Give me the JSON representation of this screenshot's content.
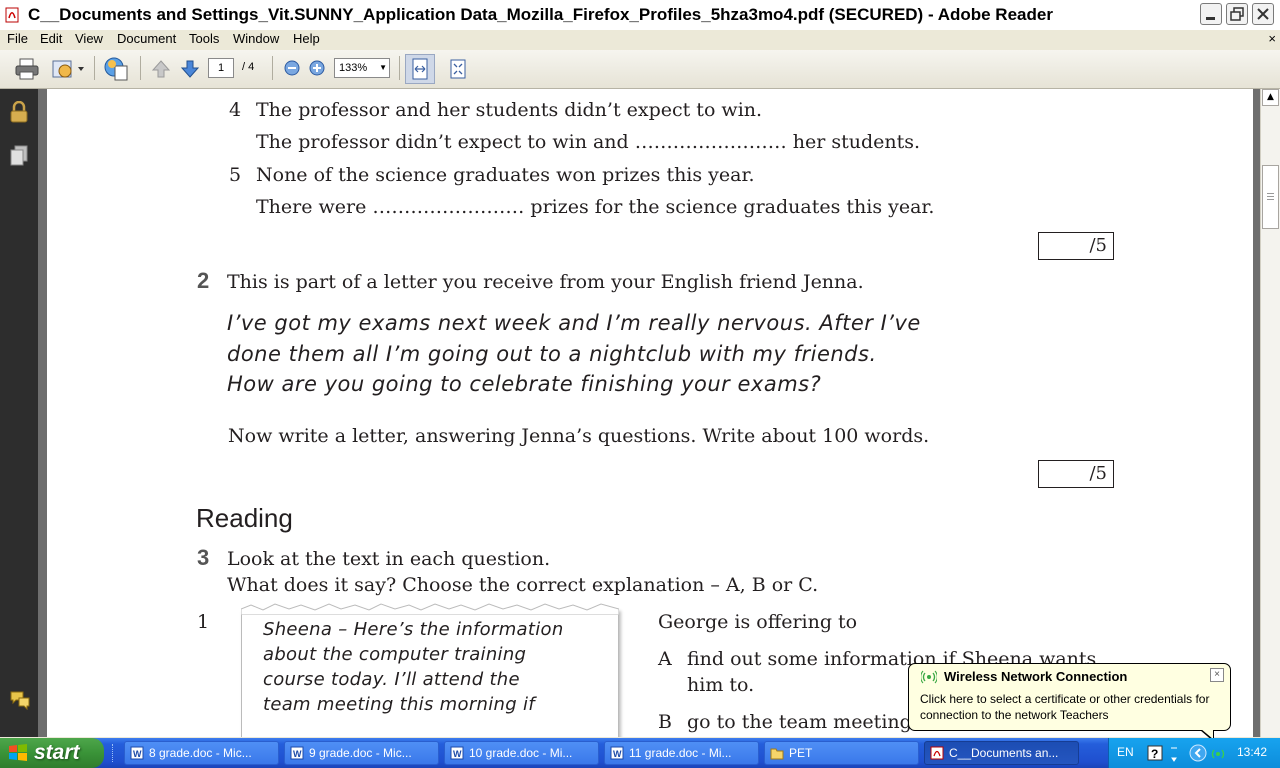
{
  "window": {
    "title": "C__Documents and Settings_Vit.SUNNY_Application Data_Mozilla_Firefox_Profiles_5hza3mo4.pdf (SECURED) - Adobe Reader"
  },
  "menu": {
    "items": [
      "File",
      "Edit",
      "View",
      "Document",
      "Tools",
      "Window",
      "Help"
    ],
    "close_glyph": "×"
  },
  "toolbar": {
    "page_current": "1",
    "page_total": "/ 4",
    "zoom": "133%"
  },
  "document": {
    "item4_num": "4",
    "item4_line1": "The professor and her students didn’t expect to win.",
    "item4_line2": "The professor didn’t expect to win and …………………… her students.",
    "item5_num": "5",
    "item5_line1": "None of the science graduates won prizes this year.",
    "item5_line2": "There were …………………… prizes for the science graduates this year.",
    "score1": "/5",
    "q2_num": "2",
    "q2_text": "This is part of a letter you receive from your English friend Jenna.",
    "letter_lines": [
      "I’ve got my exams next week and I’m really nervous. After I’ve",
      "done them all I’m going out to a nightclub with my friends.",
      "How are you going to celebrate finishing your exams?"
    ],
    "q2_instruction": "Now write a letter, answering Jenna’s questions. Write about 100 words.",
    "score2": "/5",
    "section_reading": "Reading",
    "q3_num": "3",
    "q3_line1": "Look at the text in each question.",
    "q3_line2": "What does it say? Choose the correct explanation – A, B or C.",
    "sub1_num": "1",
    "note_lines": [
      "Sheena – Here’s the information",
      "about the computer training",
      "course today. I’ll attend the",
      "team meeting this morning if"
    ],
    "george_intro": "George is offering to",
    "option_a_letter": "A",
    "option_a_line1": "find out some information if Sheena wants",
    "option_a_line2": "him to.",
    "option_b_letter": "B",
    "option_b_text": "go to the team meeting"
  },
  "balloon": {
    "title": "Wireless Network Connection",
    "body": "Click here to select a certificate or other credentials for connection to the network Teachers",
    "close_glyph": "×"
  },
  "taskbar": {
    "start_label": "start",
    "buttons": [
      {
        "label": "8 grade.doc - Mic..."
      },
      {
        "label": "9 grade.doc - Mic..."
      },
      {
        "label": "10 grade.doc - Mi..."
      },
      {
        "label": "11 grade.doc - Mi..."
      },
      {
        "label": "PET"
      },
      {
        "label": "C__Documents an..."
      }
    ],
    "language": "EN",
    "clock": "13:42"
  },
  "colors": {
    "taskbar_blue": "#245edb",
    "start_green": "#3a9338",
    "balloon_bg": "#ffffe1",
    "nav_panel": "#2d2d2d"
  }
}
